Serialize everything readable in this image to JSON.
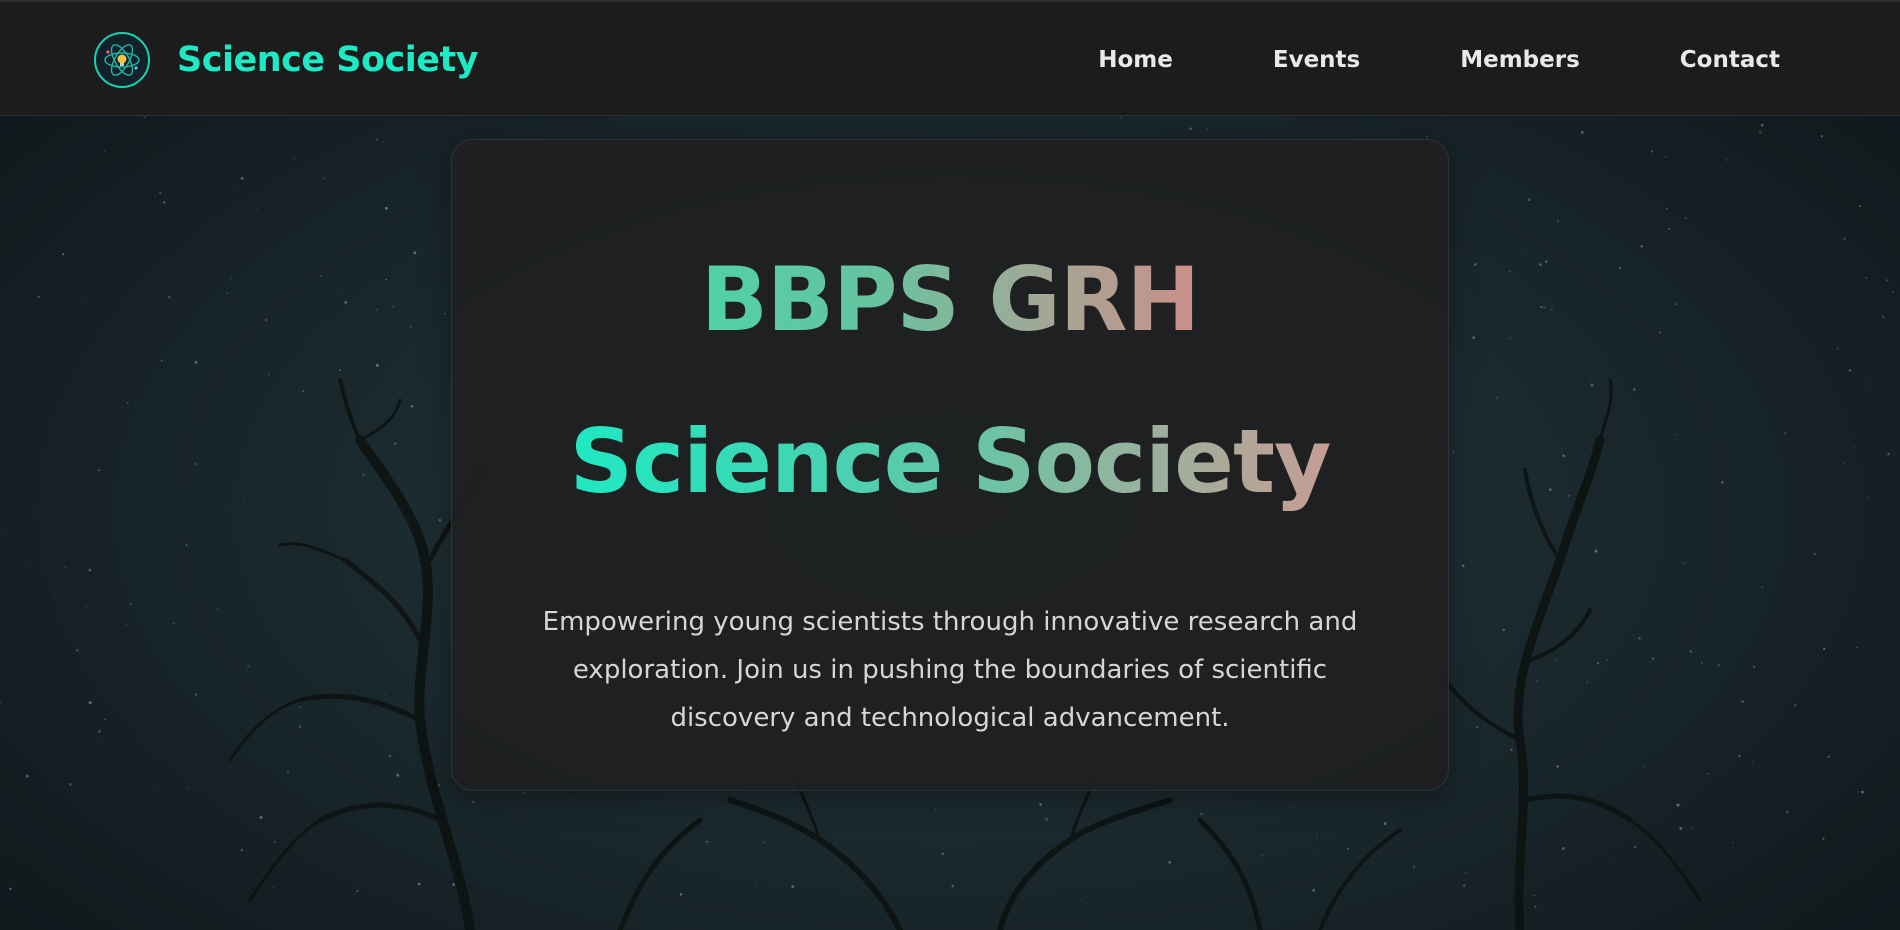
{
  "navbar": {
    "brand_title": "Science Society",
    "links": [
      {
        "label": "Home"
      },
      {
        "label": "Events"
      },
      {
        "label": "Members"
      },
      {
        "label": "Contact"
      }
    ]
  },
  "hero": {
    "title_line1": "BBPS GRH",
    "title_line2": "Science Society",
    "description": "Empowering young scientists through innovative research and exploration. Join us in pushing the boundaries of scientific discovery and technological advancement."
  },
  "icons": {
    "logo": "atom-lightbulb-icon"
  },
  "colors": {
    "accent": "#1de9c4",
    "navbar_bg": "#1c1c1c",
    "card_bg": "#1e1f20",
    "nav_text": "#e9e9e9",
    "body_text": "#d4d7d6"
  }
}
